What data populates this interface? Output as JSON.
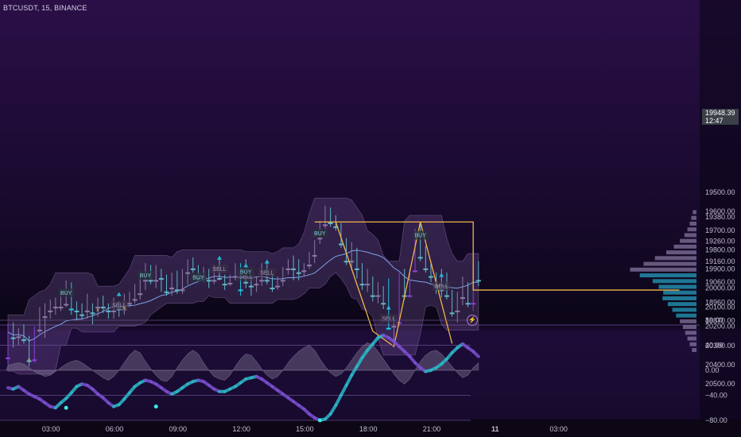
{
  "header": {
    "symbol_label": "BTCUSDT, 15, BINANCE"
  },
  "last_price": {
    "value": "19948.39",
    "countdown": "12:47"
  },
  "price_axis": [
    "20500.00",
    "20400.00",
    "20300.00",
    "20200.00",
    "20100.00",
    "20000.00",
    "19900.00",
    "19800.00",
    "19700.00",
    "19600.00",
    "19500.00",
    "19380.00",
    "19260.00",
    "19160.00",
    "19060.00",
    "18960.00",
    "18870.00"
  ],
  "oscillator_axis": [
    "80.00",
    "40.00",
    "0.00",
    "−40.00",
    "−80.00"
  ],
  "time_axis": [
    "03:00",
    "06:00",
    "09:00",
    "12:00",
    "15:00",
    "18:00",
    "21:00",
    "11",
    "03:00"
  ],
  "chart_data": {
    "type": "candlestick",
    "title": "BTCUSDT, 15, BINANCE",
    "x_start": "01:00",
    "x_interval_minutes": 15,
    "ohlc": [
      [
        20365,
        20395,
        20185,
        20230
      ],
      [
        20240,
        20310,
        20180,
        20260
      ],
      [
        20255,
        20300,
        20210,
        20240
      ],
      [
        20245,
        20290,
        20190,
        20270
      ],
      [
        20270,
        20410,
        20250,
        20380
      ],
      [
        20375,
        20390,
        20200,
        20210
      ],
      [
        20220,
        20235,
        20100,
        20120
      ],
      [
        20150,
        20260,
        20080,
        20110
      ],
      [
        20120,
        20160,
        20060,
        20100
      ],
      [
        20100,
        20140,
        20050,
        20080
      ],
      [
        20100,
        20120,
        20020,
        20080
      ],
      [
        20085,
        20100,
        19960,
        19980
      ],
      [
        19985,
        20140,
        19970,
        20110
      ],
      [
        20110,
        20170,
        20070,
        20120
      ],
      [
        20130,
        20160,
        20080,
        20140
      ],
      [
        20120,
        20160,
        20030,
        20100
      ],
      [
        20110,
        20190,
        20080,
        20130
      ],
      [
        20100,
        20150,
        20050,
        20080
      ],
      [
        20090,
        20130,
        20040,
        20100
      ],
      [
        20100,
        20160,
        20080,
        20120
      ],
      [
        20120,
        20160,
        20050,
        20080
      ],
      [
        20090,
        20150,
        20070,
        20110
      ],
      [
        20110,
        20140,
        20030,
        20090
      ],
      [
        20080,
        20100,
        20020,
        20060
      ],
      [
        20060,
        20080,
        19980,
        20050
      ],
      [
        20030,
        20060,
        19940,
        19950
      ],
      [
        19960,
        20010,
        19870,
        19890
      ],
      [
        19900,
        19980,
        19880,
        19960
      ],
      [
        19960,
        20000,
        19880,
        19920
      ],
      [
        19920,
        20020,
        19900,
        19950
      ],
      [
        19950,
        20040,
        19930,
        20020
      ],
      [
        20000,
        20040,
        19920,
        19940
      ],
      [
        19930,
        20030,
        19910,
        20010
      ],
      [
        20010,
        20030,
        19900,
        19930
      ],
      [
        19920,
        19980,
        19850,
        19870
      ],
      [
        19880,
        19920,
        19840,
        19900
      ],
      [
        19900,
        19970,
        19880,
        19950
      ],
      [
        19940,
        19970,
        19890,
        19930
      ],
      [
        19930,
        20000,
        19900,
        19960
      ],
      [
        19960,
        19980,
        19880,
        19900
      ],
      [
        19900,
        19960,
        19840,
        19950
      ],
      [
        19950,
        20010,
        19930,
        19980
      ],
      [
        19975,
        19990,
        19930,
        19940
      ],
      [
        19940,
        19960,
        19870,
        19900
      ],
      [
        19890,
        20040,
        19870,
        20010
      ],
      [
        19870,
        20000,
        19850,
        19970
      ],
      [
        19960,
        20040,
        19930,
        19990
      ],
      [
        19980,
        20020,
        19940,
        19960
      ],
      [
        19960,
        19990,
        19870,
        19880
      ],
      [
        19890,
        19980,
        19860,
        19960
      ],
      [
        19950,
        20020,
        19930,
        20000
      ],
      [
        19990,
        20010,
        19940,
        19960
      ],
      [
        19960,
        19990,
        19890,
        19910
      ],
      [
        19900,
        19930,
        19850,
        19880
      ],
      [
        19880,
        19960,
        19830,
        19900
      ],
      [
        19900,
        19960,
        19850,
        19920
      ],
      [
        19910,
        19940,
        19870,
        19890
      ],
      [
        19880,
        19900,
        19810,
        19830
      ],
      [
        19830,
        19870,
        19750,
        19760
      ],
      [
        19740,
        19770,
        19650,
        19670
      ],
      [
        19670,
        19690,
        19570,
        19620
      ],
      [
        19630,
        19680,
        19580,
        19660
      ],
      [
        19660,
        19700,
        19620,
        19680
      ],
      [
        19680,
        19790,
        19660,
        19770
      ],
      [
        19760,
        19880,
        19740,
        19860
      ],
      [
        19860,
        19910,
        19760,
        19790
      ],
      [
        19800,
        19950,
        19790,
        19900
      ],
      [
        19880,
        20010,
        19870,
        19980
      ],
      [
        19980,
        20020,
        19900,
        19960
      ],
      [
        19960,
        20070,
        19940,
        20040
      ],
      [
        20040,
        20080,
        19970,
        20020
      ],
      [
        20020,
        20110,
        19990,
        20080
      ],
      [
        19960,
        20220,
        19950,
        20210
      ],
      [
        20200,
        20310,
        20150,
        20180
      ],
      [
        20180,
        20200,
        19920,
        19940
      ],
      [
        19950,
        20060,
        19900,
        20040
      ],
      [
        20040,
        20050,
        19900,
        19920
      ],
      [
        19910,
        19920,
        19690,
        19740
      ],
      [
        19750,
        19860,
        19660,
        19840
      ],
      [
        19850,
        19920,
        19780,
        19900
      ],
      [
        19900,
        19970,
        19860,
        19940
      ],
      [
        19940,
        20030,
        19920,
        19990
      ],
      [
        19990,
        20050,
        19900,
        20010
      ],
      [
        20000,
        20060,
        19920,
        20040
      ],
      [
        20030,
        20150,
        20010,
        20130
      ],
      [
        20120,
        20180,
        20020,
        20050
      ],
      [
        20050,
        20090,
        19940,
        19980
      ],
      [
        19990,
        20100,
        19970,
        20080
      ],
      [
        20080,
        20120,
        19900,
        19940
      ],
      [
        19940,
        19990,
        19860,
        19960
      ]
    ],
    "signals": [
      {
        "label": "BUY",
        "type": "buy",
        "bar": 11
      },
      {
        "label": "SELL",
        "type": "sell",
        "bar": 21
      },
      {
        "label": "BUY",
        "type": "buy",
        "bar": 26
      },
      {
        "label": "SELL",
        "type": "sell",
        "bar": 40
      },
      {
        "label": "BUY",
        "type": "buy",
        "bar": 36
      },
      {
        "label": "SELL",
        "type": "sell",
        "bar": 45
      },
      {
        "label": "BUY",
        "type": "buy",
        "bar": 45
      },
      {
        "label": "SELL",
        "type": "sell",
        "bar": 49
      },
      {
        "label": "BUY",
        "type": "buy",
        "bar": 59
      },
      {
        "label": "SELL",
        "type": "sell",
        "bar": 72
      },
      {
        "label": "BUY",
        "type": "buy",
        "bar": 78
      },
      {
        "label": "SELL",
        "type": "sell",
        "bar": 82
      }
    ],
    "x_marks": [
      {
        "bar": 4
      },
      {
        "bar": 17
      },
      {
        "bar": 22
      }
    ],
    "zigzag": [
      [
        62,
        19655
      ],
      [
        69,
        20225
      ],
      [
        73,
        20305
      ],
      [
        78,
        19655
      ],
      [
        84,
        20290
      ]
    ],
    "step_line": [
      [
        58,
        19655
      ],
      [
        88,
        19655
      ],
      [
        88,
        19020
      ],
      [
        127,
        19020
      ]
    ],
    "volume_profile": [
      [
        20330,
        6
      ],
      [
        20300,
        9
      ],
      [
        20270,
        12
      ],
      [
        20240,
        15
      ],
      [
        20210,
        18
      ],
      [
        20180,
        22
      ],
      [
        20150,
        27
      ],
      [
        20120,
        32
      ],
      [
        20090,
        38
      ],
      [
        20060,
        45
      ],
      [
        20030,
        44
      ],
      [
        20000,
        50
      ],
      [
        19970,
        58
      ],
      [
        19940,
        75
      ],
      [
        19910,
        88
      ],
      [
        19880,
        70
      ],
      [
        19850,
        55
      ],
      [
        19820,
        40
      ],
      [
        19790,
        30
      ],
      [
        19760,
        22
      ],
      [
        19730,
        16
      ],
      [
        19700,
        12
      ],
      [
        19670,
        9
      ],
      [
        19640,
        7
      ],
      [
        19610,
        5
      ]
    ],
    "oscillator": {
      "main": [
        -28,
        -30,
        -26,
        -32,
        -38,
        -42,
        -46,
        -52,
        -58,
        -60,
        -52,
        -45,
        -36,
        -26,
        -22,
        -24,
        -30,
        -38,
        -44,
        -52,
        -58,
        -55,
        -46,
        -36,
        -26,
        -20,
        -16,
        -18,
        -22,
        -28,
        -34,
        -38,
        -34,
        -28,
        -22,
        -18,
        -16,
        -18,
        -24,
        -30,
        -34,
        -34,
        -30,
        -26,
        -20,
        -14,
        -12,
        -10,
        -14,
        -20,
        -26,
        -32,
        -38,
        -44,
        -50,
        -56,
        -62,
        -70,
        -76,
        -80,
        -78,
        -70,
        -56,
        -40,
        -24,
        -8,
        6,
        20,
        32,
        42,
        52,
        56,
        52,
        46,
        38,
        30,
        22,
        12,
        4,
        -2,
        0,
        4,
        10,
        18,
        28,
        36,
        42,
        36,
        30,
        22
      ],
      "histogram": [
        8,
        10,
        12,
        10,
        4,
        -2,
        -6,
        -10,
        -8,
        -2,
        4,
        10,
        14,
        16,
        12,
        6,
        0,
        -6,
        -12,
        -16,
        -10,
        0,
        12,
        24,
        32,
        28,
        14,
        2,
        -8,
        -16,
        -18,
        -10,
        4,
        16,
        26,
        32,
        26,
        12,
        0,
        -10,
        -14,
        -16,
        -8,
        6,
        18,
        26,
        24,
        14,
        2,
        -8,
        -14,
        -10,
        0,
        12,
        22,
        30,
        36,
        40,
        32,
        18,
        6,
        -4,
        -10,
        -6,
        4,
        16,
        28,
        38,
        44,
        40,
        30,
        18,
        6,
        -6,
        -16,
        -22,
        -14,
        0,
        14,
        24,
        30,
        32,
        26,
        16,
        6,
        -4,
        -12,
        -8,
        4,
        12
      ]
    }
  }
}
